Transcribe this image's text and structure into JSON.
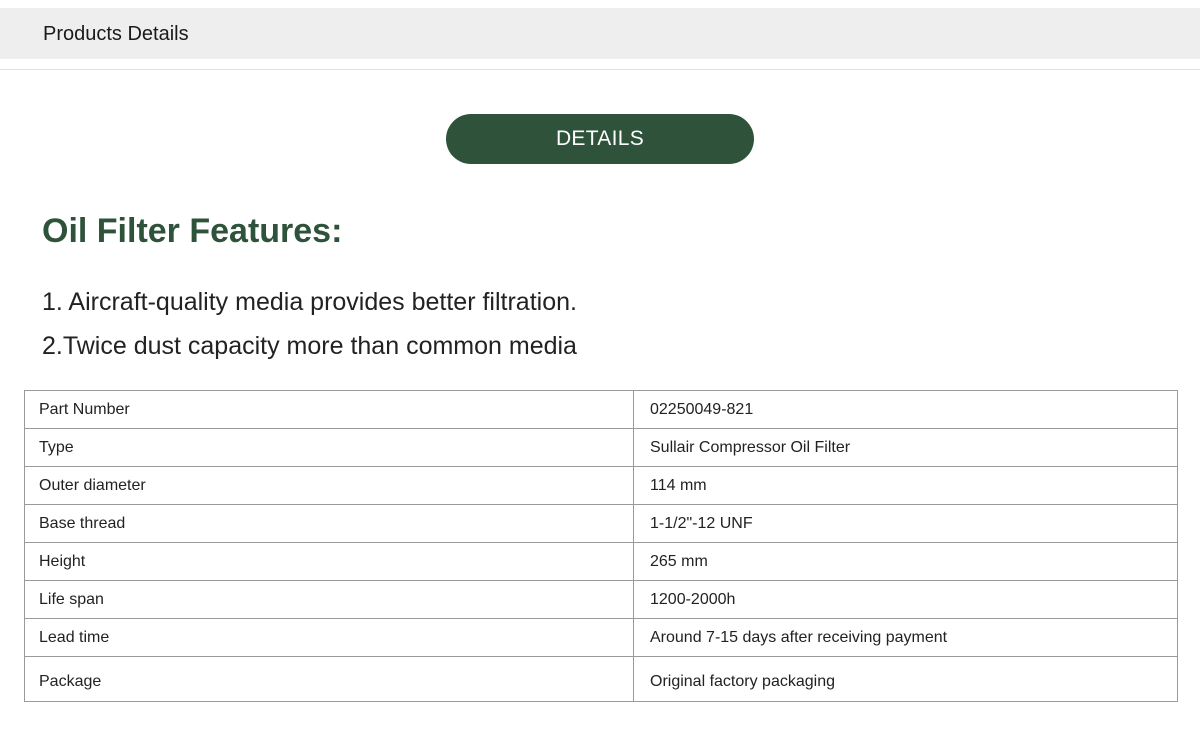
{
  "header": {
    "tab_title": "Products Details"
  },
  "main": {
    "details_button_label": "DETAILS",
    "features_heading": "Oil Filter Features:",
    "features": [
      "1. Aircraft-quality media provides better filtration.",
      "2.Twice dust capacity more than common media"
    ],
    "spec_table": {
      "rows": [
        {
          "label": "Part Number",
          "value": "02250049-821"
        },
        {
          "label": "Type",
          "value": "Sullair Compressor Oil Filter"
        },
        {
          "label": "Outer diameter",
          "value": "114 mm"
        },
        {
          "label": "Base thread",
          "value": "1-1/2\"-12 UNF"
        },
        {
          "label": "Height",
          "value": "265 mm"
        },
        {
          "label": "Life span",
          "value": "1200-2000h"
        },
        {
          "label": "Lead time",
          "value": "Around 7-15 days after receiving payment"
        },
        {
          "label": "Package",
          "value": "Original factory packaging"
        }
      ]
    }
  },
  "colors": {
    "accent_green": "#2e523a",
    "tab_bar_bg": "#eeeeee",
    "table_border": "#9a9a9a"
  }
}
